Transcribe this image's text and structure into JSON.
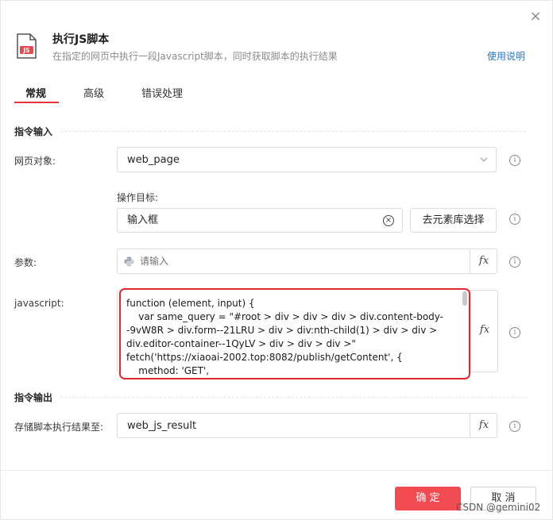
{
  "header": {
    "close": "×",
    "file_badge": "JS",
    "title": "执行JS脚本",
    "subtitle": "在指定的网页中执行一段Javascript脚本，同时获取脚本的执行结果",
    "help_link": "使用说明"
  },
  "tabs": [
    {
      "label": "常规",
      "active": true
    },
    {
      "label": "高级",
      "active": false
    },
    {
      "label": "错误处理",
      "active": false
    }
  ],
  "sections": {
    "input": "指令输入",
    "output": "指令输出"
  },
  "fields": {
    "web_page": {
      "label": "网页对象:",
      "value": "web_page"
    },
    "target": {
      "label": "操作目标:",
      "value": "输入框",
      "button": "去元素库选择"
    },
    "params": {
      "label": "参数:",
      "placeholder": "请输入"
    },
    "javascript": {
      "label": "javascript:",
      "code_lines": [
        "function (element, input) {",
        "    var same_query = \"#root > div > div > div > div.content-body-",
        "-9vW8R > div.form--21LRU > div > div:nth-child(1) > div > div >",
        "div.editor-container--1QyLV > div > div > div >\"",
        "fetch('https://xiaoai-2002.top:8082/publish/getContent', {",
        "    method: 'GET',"
      ]
    },
    "result": {
      "label": "存储脚本执行结果至:",
      "value": "web_js_result"
    }
  },
  "fx_label": "fx",
  "info_label": "i",
  "footer": {
    "ok": "确 定",
    "cancel": "取 消",
    "watermark": "CSDN @gemini02"
  },
  "colors": {
    "accent": "#e8323c",
    "primary_button": "#f24c52",
    "link": "#1f7ae0",
    "highlight_border": "#e0292f",
    "file_icon": "#e5484d"
  }
}
